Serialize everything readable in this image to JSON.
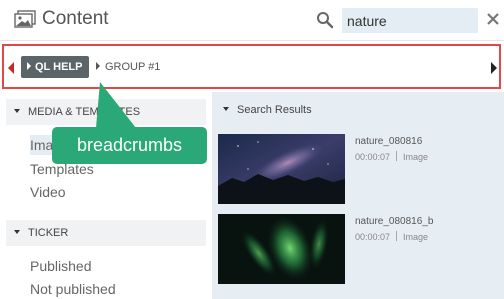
{
  "header": {
    "title": "Content",
    "search_value": "nature",
    "icons": [
      "image-icon",
      "search-icon",
      "close-icon"
    ]
  },
  "breadcrumbs": {
    "items": [
      "QL HELP",
      "GROUP #1"
    ],
    "border_color": "#e2484a"
  },
  "sidebar": {
    "sections": [
      {
        "label": "MEDIA & TEMPLATES",
        "items": [
          "Images",
          "Templates",
          "Video"
        ]
      },
      {
        "label": "TICKER",
        "items": [
          "Published",
          "Not published"
        ]
      }
    ]
  },
  "results": {
    "heading": "Search Results",
    "items": [
      {
        "name": "nature_080816",
        "duration": "00:00:07",
        "type": "Image"
      },
      {
        "name": "nature_080816_b",
        "duration": "00:00:07",
        "type": "Image"
      }
    ]
  },
  "callout": {
    "text": "breadcrumbs",
    "color": "#2aa877"
  }
}
